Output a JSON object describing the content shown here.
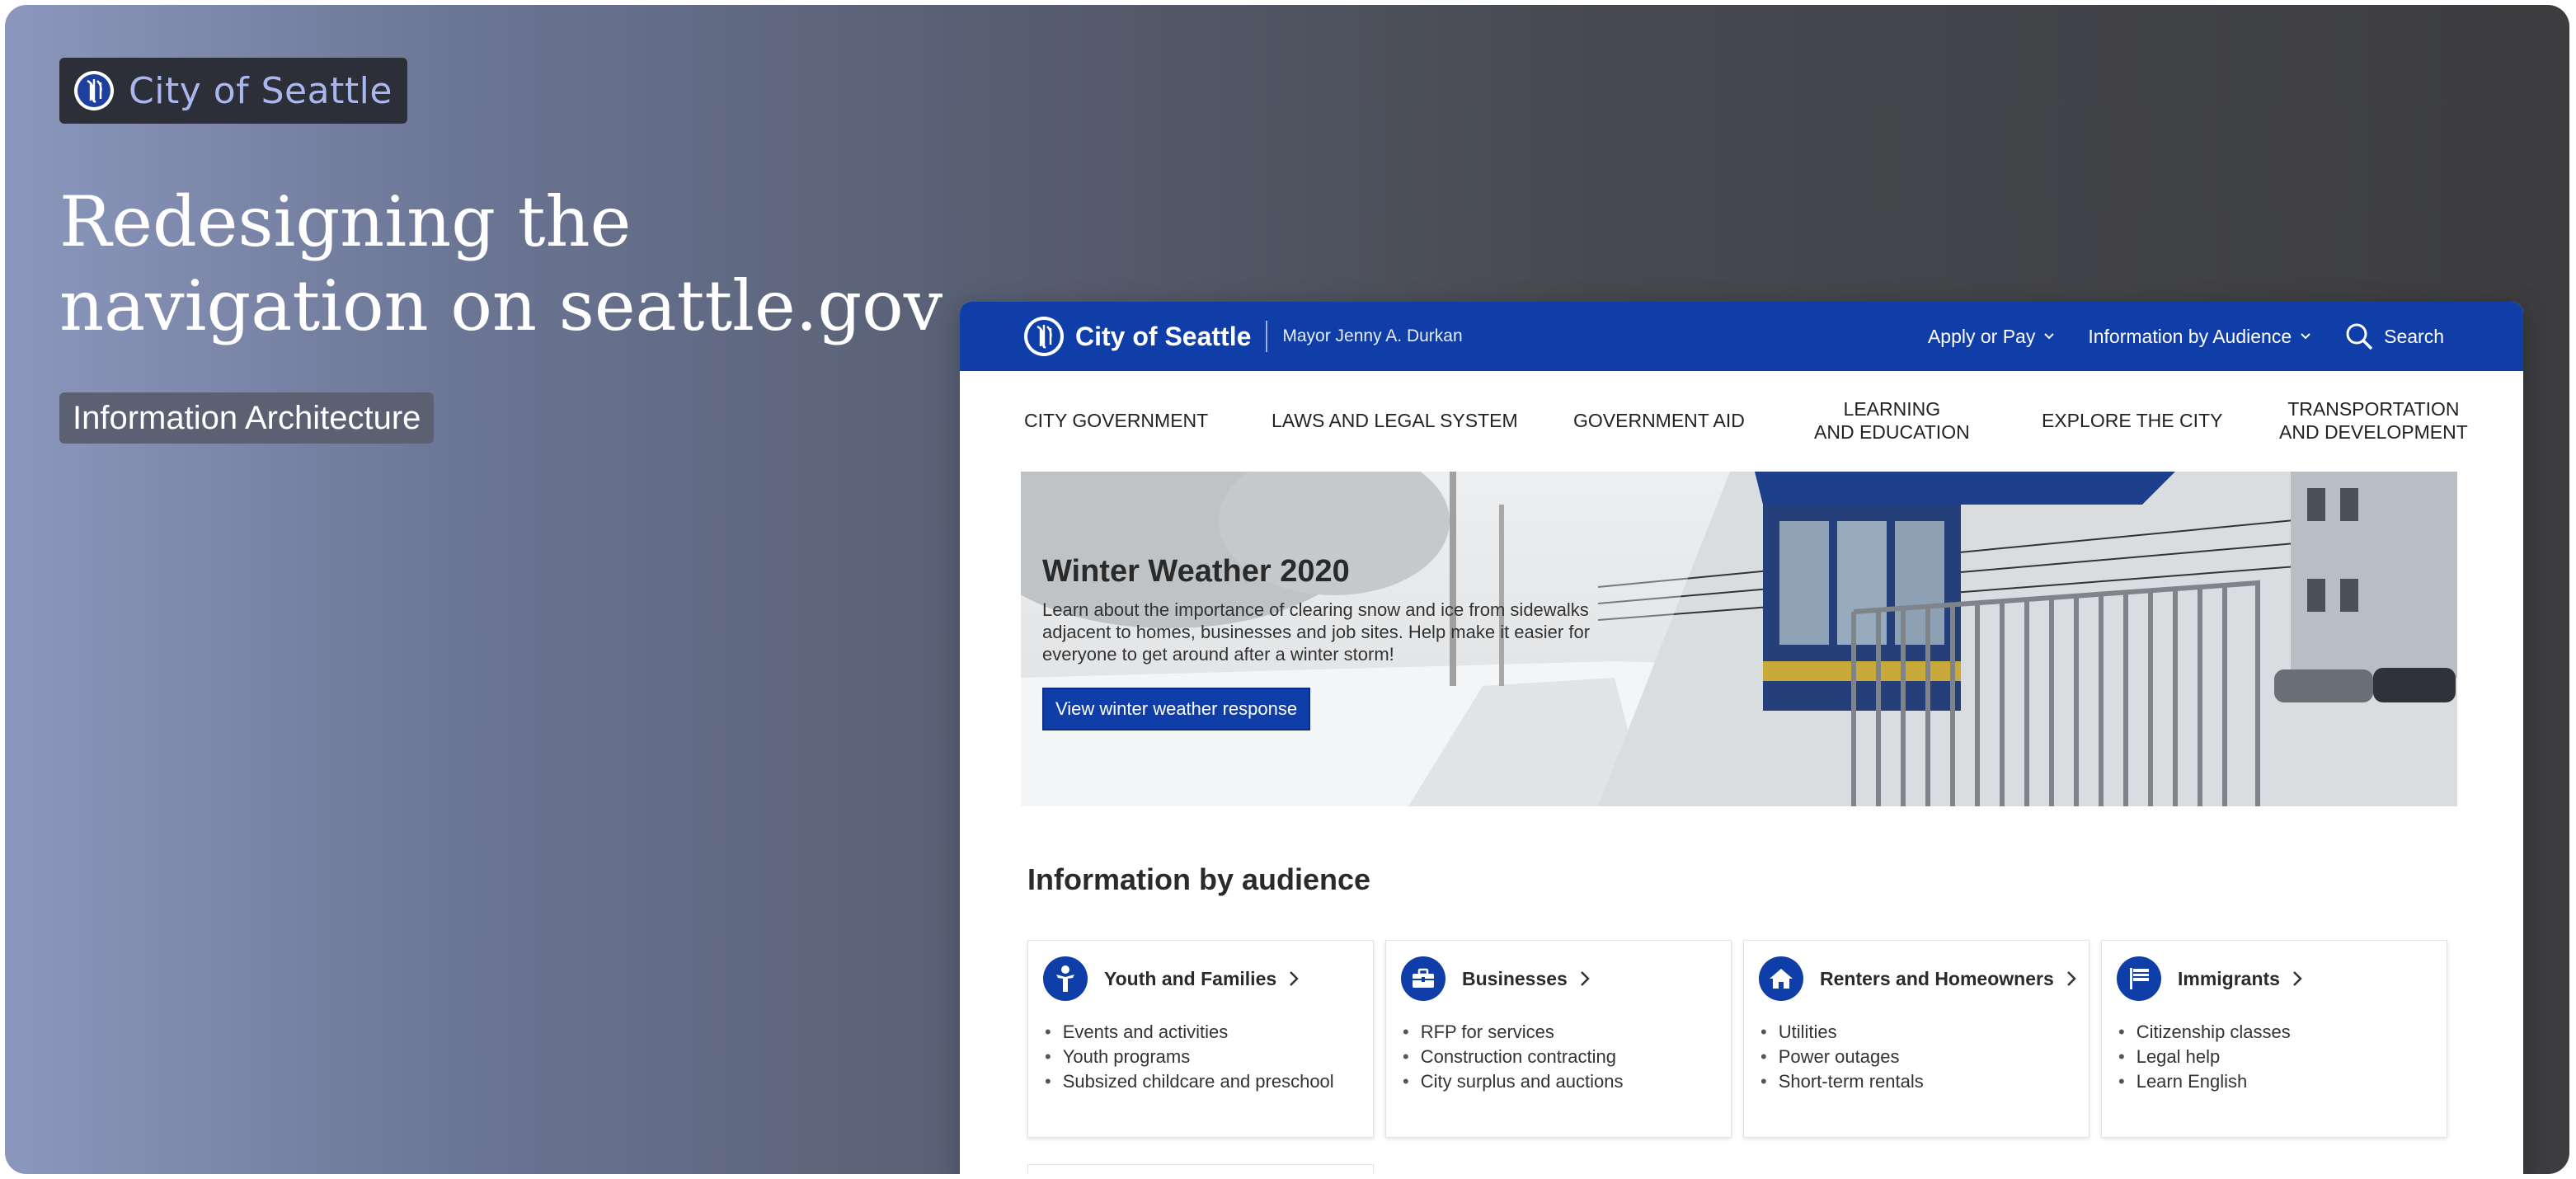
{
  "showcase": {
    "badge_text": "City of Seattle",
    "headline_line1": "Redesigning the",
    "headline_line2": "navigation on seattle.gov",
    "tag": "Information Architecture",
    "background_gradient": [
      "#8b97bd",
      "#3d3d40"
    ]
  },
  "site": {
    "brand_name": "City of Seattle",
    "mayor": "Mayor Jenny A. Durkan",
    "accent": "#0f3ea8",
    "top_nav": [
      {
        "label": "Apply or Pay",
        "icon": "chevron-down-icon"
      },
      {
        "label": "Information by Audience",
        "icon": "chevron-down-icon"
      }
    ],
    "search_label": "Search",
    "main_nav": [
      {
        "line1": "CITY GOVERNMENT",
        "line2": ""
      },
      {
        "line1": "LAWS AND LEGAL SYSTEM",
        "line2": ""
      },
      {
        "line1": "GOVERNMENT AID",
        "line2": ""
      },
      {
        "line1": "LEARNING",
        "line2": "AND EDUCATION"
      },
      {
        "line1": "EXPLORE THE CITY",
        "line2": ""
      },
      {
        "line1": "TRANSPORTATION",
        "line2": "AND DEVELOPMENT"
      }
    ],
    "hero": {
      "title": "Winter Weather 2020",
      "description": "Learn about the importance of clearing snow and ice from sidewalks adjacent to homes, businesses and job sites. Help make it easier for everyone to get around after a winter storm!",
      "button": "View winter weather response"
    },
    "section_title": "Information by audience",
    "cards": [
      {
        "title": "Youth and Families",
        "icon": "person-icon",
        "items": [
          "Events and activities",
          "Youth programs",
          "Subsized childcare and preschool"
        ]
      },
      {
        "title": "Businesses",
        "icon": "briefcase-icon",
        "items": [
          "RFP for services",
          "Construction contracting",
          "City surplus and auctions"
        ]
      },
      {
        "title": "Renters and Homeowners",
        "icon": "house-icon",
        "items": [
          "Utilities",
          "Power outages",
          "Short-term rentals"
        ]
      },
      {
        "title": "Immigrants",
        "icon": "flag-icon",
        "items": [
          "Citizenship classes",
          "Legal help",
          "Learn English"
        ]
      }
    ]
  }
}
